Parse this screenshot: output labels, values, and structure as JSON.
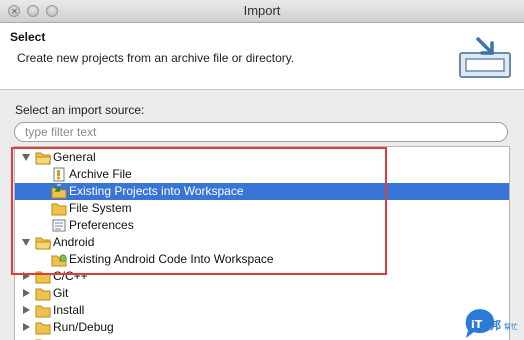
{
  "window": {
    "title": "Import"
  },
  "header": {
    "title": "Select",
    "description": "Create new projects from an archive file or directory."
  },
  "source": {
    "prompt": "Select an import source:",
    "filter_placeholder": "type filter text"
  },
  "tree": {
    "general": {
      "label": "General",
      "expanded": true
    },
    "archive_file": {
      "label": "Archive File"
    },
    "existing_projects": {
      "label": "Existing Projects into Workspace",
      "selected": true
    },
    "file_system": {
      "label": "File System"
    },
    "preferences": {
      "label": "Preferences"
    },
    "android": {
      "label": "Android",
      "expanded": true
    },
    "existing_android": {
      "label": "Existing Android Code Into Workspace"
    },
    "cpp": {
      "label": "C/C++",
      "expanded": false
    },
    "git": {
      "label": "Git",
      "expanded": false
    },
    "install": {
      "label": "Install",
      "expanded": false
    },
    "run_debug": {
      "label": "Run/Debug",
      "expanded": false
    }
  },
  "colors": {
    "selection": "#3875d7",
    "annotation_box": "#e03c3c",
    "folder": "#f0c24a"
  },
  "icons": [
    "folder-icon",
    "archive-file-icon",
    "existing-projects-icon",
    "file-system-icon",
    "preferences-icon",
    "android-import-icon",
    "import-wizard-icon"
  ],
  "watermark": {
    "text": "iT邦幫忙"
  }
}
